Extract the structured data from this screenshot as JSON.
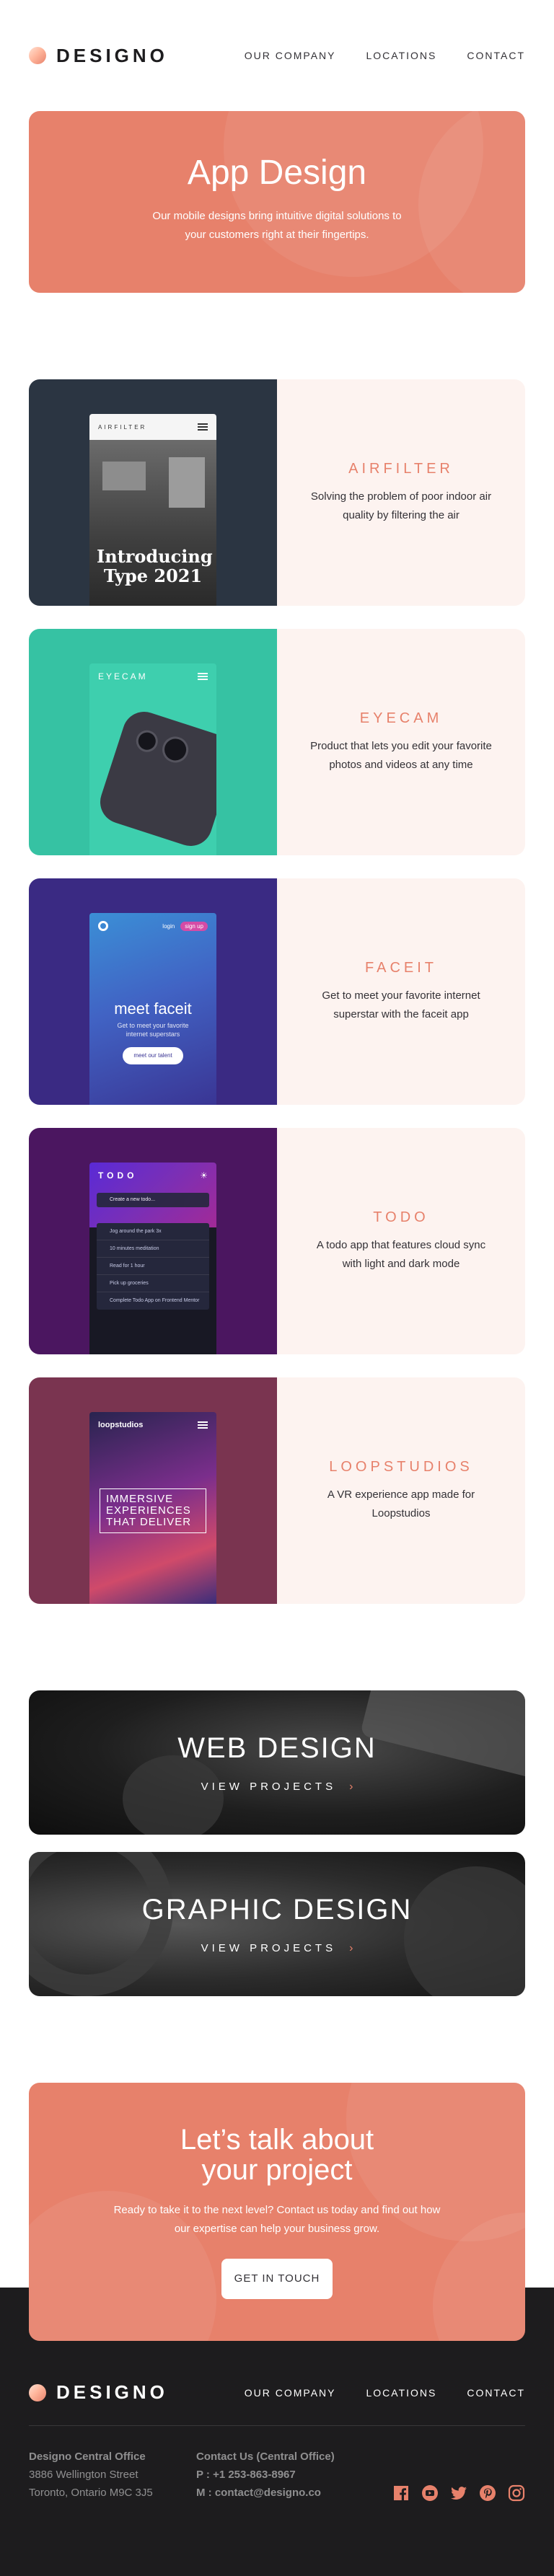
{
  "brand": {
    "name": "DESIGNO"
  },
  "nav": [
    "OUR COMPANY",
    "LOCATIONS",
    "CONTACT"
  ],
  "hero": {
    "title": "App Design",
    "description": "Our mobile designs bring intuitive digital solutions to your customers right at their fingertips."
  },
  "projects": [
    {
      "title": "AIRFILTER",
      "description": "Solving the problem of poor indoor air quality by filtering the air",
      "screen": {
        "brand": "AIRFILTER",
        "headline": "Introducing Type 2021"
      }
    },
    {
      "title": "EYECAM",
      "description": "Product that lets you edit your favorite photos and videos at any time",
      "screen": {
        "brand": "EYECAM"
      }
    },
    {
      "title": "FACEIT",
      "description": "Get to meet your favorite internet superstar with the faceit app",
      "screen": {
        "headline": "meet faceit",
        "sub": "Get to meet your favorite internet superstars",
        "button": "meet our talent",
        "login": "login",
        "signup": "sign up"
      }
    },
    {
      "title": "TODO",
      "description": "A todo app that features cloud sync with light and dark mode",
      "screen": {
        "brand": "TODO",
        "placeholder": "Create a new todo...",
        "items": [
          "Jog around the park 3x",
          "10 minutes meditation",
          "Read for 1 hour",
          "Pick up groceries",
          "Complete Todo App on Frontend Mentor"
        ]
      }
    },
    {
      "title": "LOOPSTUDIOS",
      "description": "A VR experience app made for Loopstudios",
      "screen": {
        "brand": "loopstudios",
        "headline": "IMMERSIVE EXPERIENCES THAT DELIVER"
      }
    }
  ],
  "categories": [
    {
      "title": "WEB DESIGN",
      "link": "VIEW PROJECTS"
    },
    {
      "title": "GRAPHIC DESIGN",
      "link": "VIEW PROJECTS"
    }
  ],
  "cta": {
    "title": "Let’s talk about your project",
    "description": "Ready to take it to the next level? Contact us today and find out how our expertise can help your business grow.",
    "button": "GET IN TOUCH"
  },
  "footer": {
    "office_title": "Designo Central Office",
    "address_line1": "3886 Wellington Street",
    "address_line2": "Toronto, Ontario M9C 3J5",
    "contact_title": "Contact Us (Central Office)",
    "phone": "P : +1 253-863-8967",
    "email": "M : contact@designo.co",
    "socials": [
      "facebook-icon",
      "youtube-icon",
      "twitter-icon",
      "pinterest-icon",
      "instagram-icon"
    ]
  },
  "colors": {
    "peach": "#e7816b",
    "light_peach": "#fdf3f0",
    "black": "#1d1c1e",
    "dark_gray": "#333136"
  }
}
